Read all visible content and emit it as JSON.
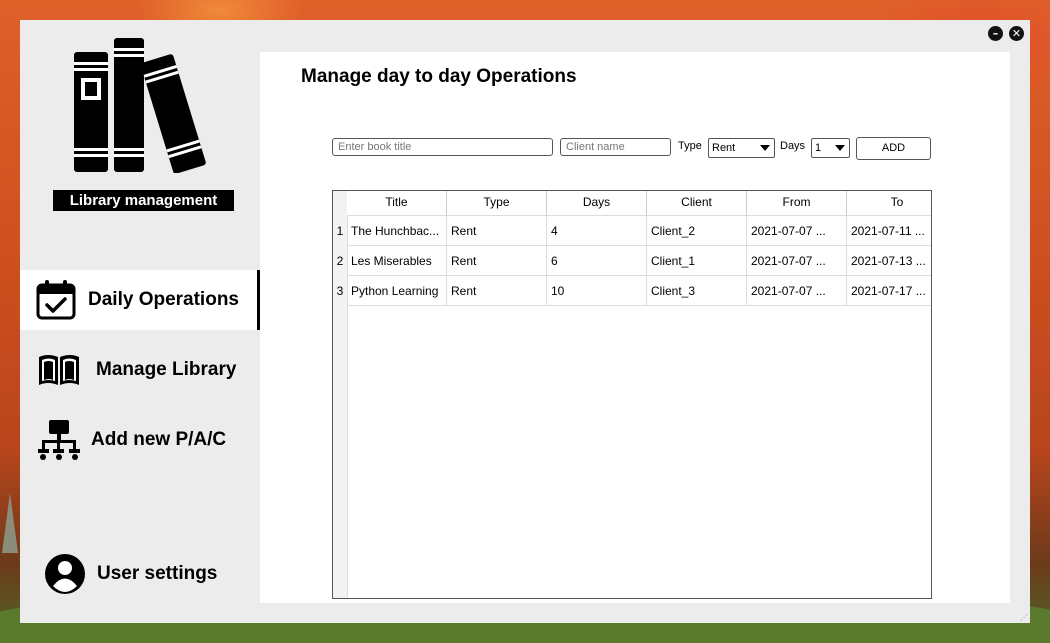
{
  "app": {
    "logo_caption": "Library management"
  },
  "window_controls": {
    "minimize": "–",
    "close": "✕"
  },
  "sidebar": {
    "items": [
      {
        "label": "Daily Operations",
        "icon": "calendar-check-icon",
        "active": true
      },
      {
        "label": "Manage Library",
        "icon": "open-book-icon",
        "active": false
      },
      {
        "label": "Add new P/A/C",
        "icon": "sitemap-icon",
        "active": false
      }
    ],
    "user_settings": {
      "label": "User settings",
      "icon": "user-circle-icon"
    }
  },
  "main": {
    "title": "Manage day to day Operations",
    "form": {
      "book_title_placeholder": "Enter book title",
      "client_name_placeholder": "Client name",
      "type_label": "Type",
      "type_value": "Rent",
      "days_label": "Days",
      "days_value": "1",
      "add_button": "ADD"
    },
    "table": {
      "columns": [
        "Title",
        "Type",
        "Days",
        "Client",
        "From",
        "To"
      ],
      "rows": [
        {
          "num": "1",
          "cells": [
            "The Hunchbac...",
            "Rent",
            "4",
            "Client_2",
            "2021-07-07 ...",
            "2021-07-11 ..."
          ]
        },
        {
          "num": "2",
          "cells": [
            "Les Miserables",
            "Rent",
            "6",
            "Client_1",
            "2021-07-07 ...",
            "2021-07-13 ..."
          ]
        },
        {
          "num": "3",
          "cells": [
            "Python Learning",
            "Rent",
            "10",
            "Client_3",
            "2021-07-07 ...",
            "2021-07-17 ..."
          ]
        }
      ]
    }
  }
}
